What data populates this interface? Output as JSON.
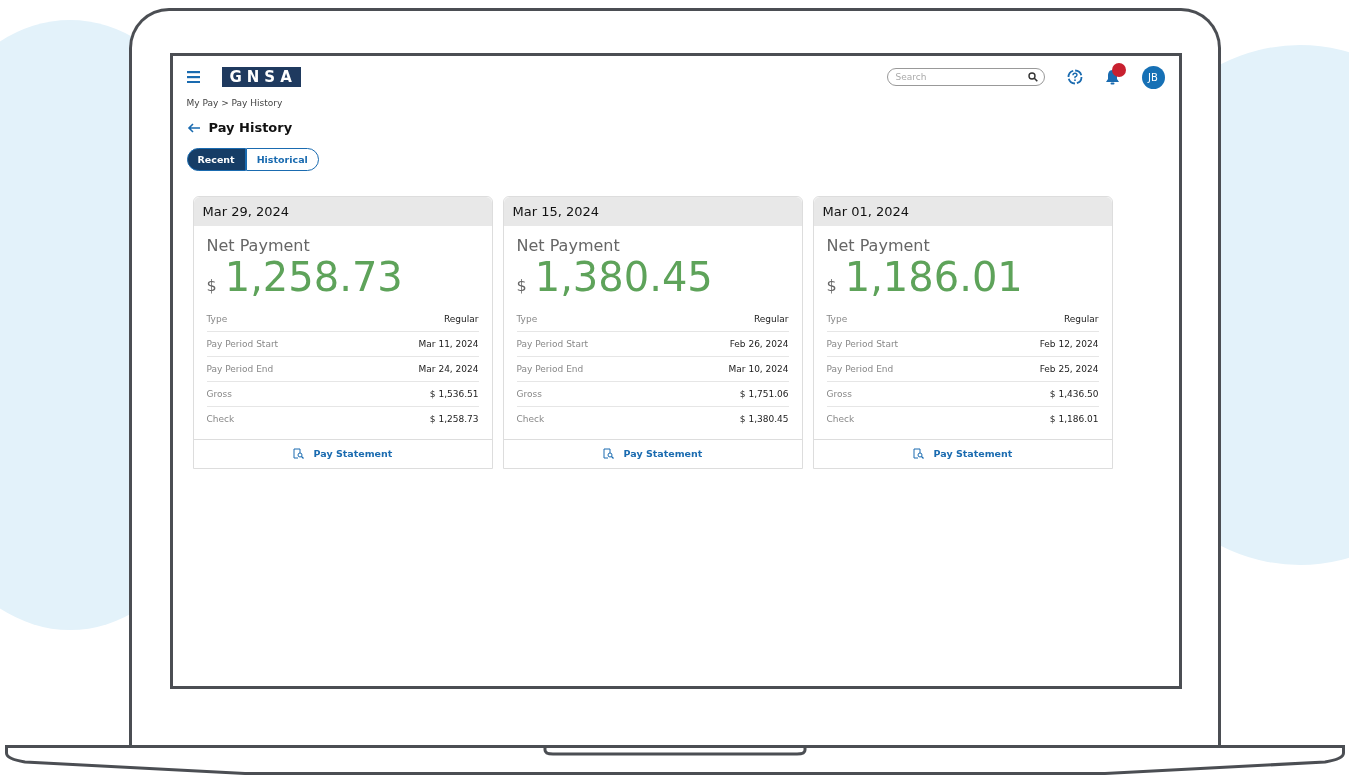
{
  "header": {
    "logo": "GNSA",
    "search": {
      "placeholder": "Search"
    },
    "notifications": {
      "unread": true
    },
    "avatar": "JB"
  },
  "breadcrumb": "My Pay > Pay History",
  "page_title": "Pay History",
  "tabs": [
    {
      "label": "Recent",
      "selected": true
    },
    {
      "label": "Historical",
      "selected": false
    }
  ],
  "cards": [
    {
      "date": "Mar 29, 2024",
      "net_label": "Net Payment",
      "currency": "$",
      "amount": "1,258.73",
      "rows": [
        {
          "label": "Type",
          "value": "Regular"
        },
        {
          "label": "Pay Period Start",
          "value": "Mar 11, 2024"
        },
        {
          "label": "Pay Period End",
          "value": "Mar 24, 2024"
        },
        {
          "label": "Gross",
          "value": "$ 1,536.51"
        },
        {
          "label": "Check",
          "value": "$ 1,258.73"
        }
      ],
      "link": "Pay Statement"
    },
    {
      "date": "Mar 15, 2024",
      "net_label": "Net Payment",
      "currency": "$",
      "amount": "1,380.45",
      "rows": [
        {
          "label": "Type",
          "value": "Regular"
        },
        {
          "label": "Pay Period Start",
          "value": "Feb 26, 2024"
        },
        {
          "label": "Pay Period End",
          "value": "Mar 10, 2024"
        },
        {
          "label": "Gross",
          "value": "$ 1,751.06"
        },
        {
          "label": "Check",
          "value": "$ 1,380.45"
        }
      ],
      "link": "Pay Statement"
    },
    {
      "date": "Mar 01, 2024",
      "net_label": "Net Payment",
      "currency": "$",
      "amount": "1,186.01",
      "rows": [
        {
          "label": "Type",
          "value": "Regular"
        },
        {
          "label": "Pay Period Start",
          "value": "Feb 12, 2024"
        },
        {
          "label": "Pay Period End",
          "value": "Feb 25, 2024"
        },
        {
          "label": "Gross",
          "value": "$ 1,436.50"
        },
        {
          "label": "Check",
          "value": "$ 1,186.01"
        }
      ],
      "link": "Pay Statement"
    }
  ]
}
